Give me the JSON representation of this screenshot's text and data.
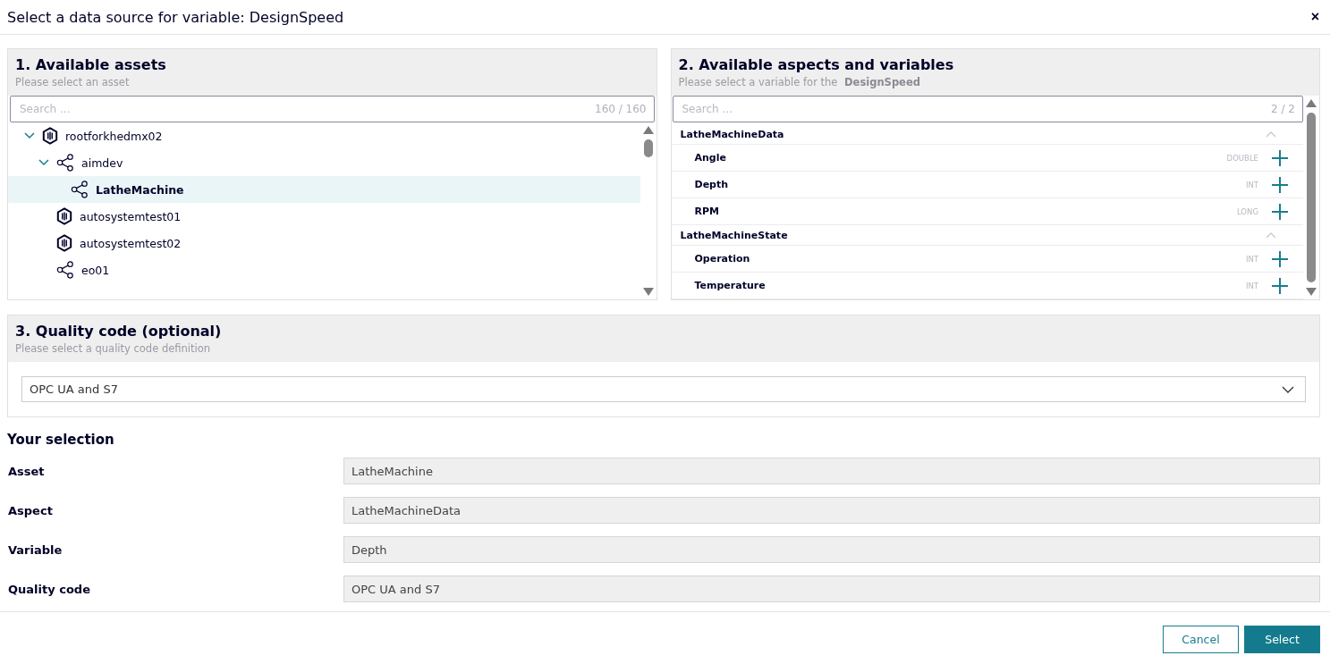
{
  "dialog": {
    "title": "Select a data source for variable: DesignSpeed",
    "close": "×"
  },
  "assets": {
    "title": "1. Available assets",
    "subtitle": "Please select an asset",
    "search": {
      "placeholder": "Search ...",
      "count": "160 / 160"
    },
    "tree": [
      {
        "label": "rootforkhedmx02",
        "kind": "asset",
        "expanded": true,
        "selected": false,
        "children": [
          {
            "label": "aimdev",
            "kind": "share",
            "expanded": true,
            "selected": false,
            "children": [
              {
                "label": "LatheMachine",
                "kind": "share",
                "selected": true
              }
            ]
          },
          {
            "label": "autosystemtest01",
            "kind": "asset",
            "selected": false
          },
          {
            "label": "autosystemtest02",
            "kind": "asset",
            "selected": false
          },
          {
            "label": "eo01",
            "kind": "share",
            "selected": false
          }
        ]
      }
    ]
  },
  "aspects": {
    "title": "2. Available aspects and variables",
    "subtitle": "Please select a variable for the **DesignSpeed**",
    "search": {
      "placeholder": "Search ...",
      "count": "2 / 2"
    },
    "groups": [
      {
        "name": "LatheMachineData",
        "expanded": true,
        "variables": [
          {
            "name": "Angle",
            "type": "DOUBLE"
          },
          {
            "name": "Depth",
            "type": "INT"
          },
          {
            "name": "RPM",
            "type": "LONG"
          }
        ]
      },
      {
        "name": "LatheMachineState",
        "expanded": true,
        "variables": [
          {
            "name": "Operation",
            "type": "INT"
          },
          {
            "name": "Temperature",
            "type": "INT"
          }
        ]
      }
    ]
  },
  "quality": {
    "title": "3. Quality code (optional)",
    "subtitle": "Please select a quality code definition",
    "value": "OPC UA and S7"
  },
  "selection": {
    "title": "Your selection",
    "rows": [
      {
        "label": "Asset",
        "value": "LatheMachine"
      },
      {
        "label": "Aspect",
        "value": "LatheMachineData"
      },
      {
        "label": "Variable",
        "value": "Depth"
      },
      {
        "label": "Quality code",
        "value": "OPC UA and S7"
      }
    ]
  },
  "buttons": [
    {
      "label": "Cancel",
      "kind": "secondary"
    },
    {
      "label": "Select",
      "kind": "primary"
    }
  ]
}
